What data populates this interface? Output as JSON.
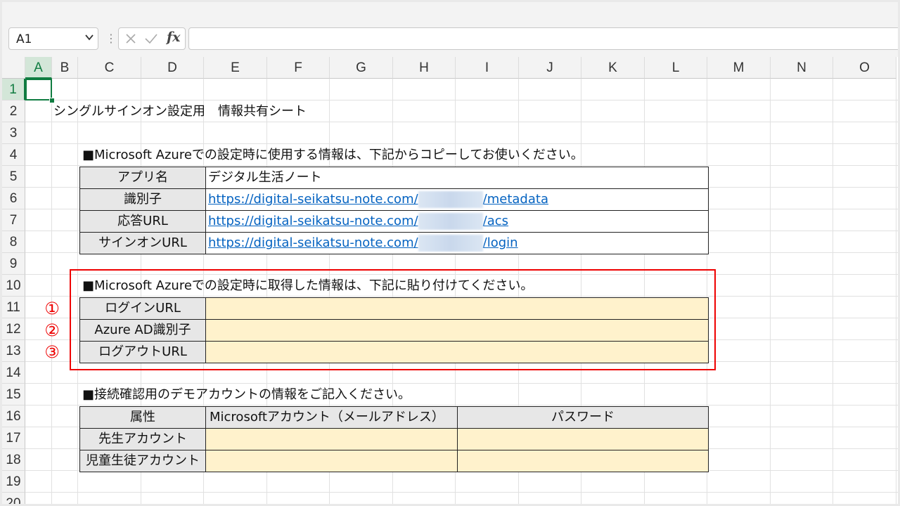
{
  "formula_bar": {
    "name_box": "A1",
    "fx_label": "fx",
    "formula": ""
  },
  "columns": [
    "A",
    "B",
    "C",
    "D",
    "E",
    "F",
    "G",
    "H",
    "I",
    "J",
    "K",
    "L",
    "M",
    "N",
    "O"
  ],
  "rows": [
    "1",
    "2",
    "3",
    "4",
    "5",
    "6",
    "7",
    "8",
    "9",
    "10",
    "11",
    "12",
    "13",
    "14",
    "15",
    "16",
    "17",
    "18",
    "19",
    "20"
  ],
  "sheet": {
    "title": "シングルサインオン設定用　情報共有シート",
    "section1": {
      "heading": "■Microsoft Azureでの設定時に使用する情報は、下記からコピーしてお使いください。",
      "rows": [
        {
          "label": "アプリ名",
          "value": "デジタル生活ノート"
        },
        {
          "label": "識別子",
          "url_prefix": "https://digital-seikatsu-note.com/",
          "url_suffix": "/metadata"
        },
        {
          "label": "応答URL",
          "url_prefix": "https://digital-seikatsu-note.com/",
          "url_suffix": "/acs"
        },
        {
          "label": "サインオンURL",
          "url_prefix": "https://digital-seikatsu-note.com/",
          "url_suffix": "/login"
        }
      ]
    },
    "section2": {
      "heading": "■Microsoft Azureでの設定時に取得した情報は、下記に貼り付けてください。",
      "rows": [
        {
          "marker": "①",
          "label": "ログインURL"
        },
        {
          "marker": "②",
          "label": "Azure AD識別子"
        },
        {
          "marker": "③",
          "label": "ログアウトURL"
        }
      ]
    },
    "section3": {
      "heading": "■接続確認用のデモアカウントの情報をご記入ください。",
      "headers": [
        "属性",
        "Microsoftアカウント（メールアドレス）",
        "パスワード"
      ],
      "rows": [
        {
          "label": "先生アカウント"
        },
        {
          "label": "児童生徒アカウント"
        }
      ]
    }
  },
  "colors": {
    "selection": "#107c41",
    "input_fill": "#fff2cc",
    "label_fill": "#e7e7e7",
    "highlight_border": "#ee0000",
    "link": "#0563c1"
  }
}
